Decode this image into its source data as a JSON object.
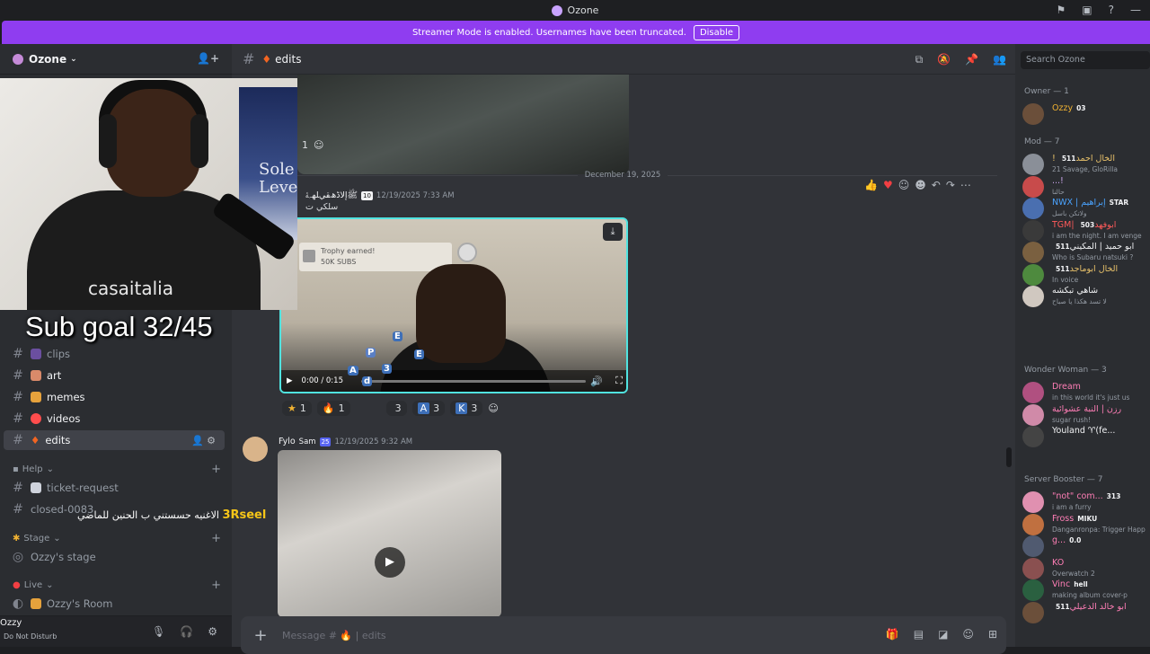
{
  "window": {
    "title": "Ozone"
  },
  "banner": {
    "text": "Streamer Mode is enabled. Usernames have been truncated.",
    "button": "Disable"
  },
  "server": {
    "name": "Ozone"
  },
  "overlay": {
    "subgoal": "Sub goal 32/45",
    "webcam_brand": "casaitalia",
    "poster_text": "Sole Level",
    "donation_name": "3Rseel",
    "donation_message": "الاغنيه حسستني ب الحنين للماضي"
  },
  "sidebar": {
    "channels": [
      {
        "label": "clips"
      },
      {
        "label": "art"
      },
      {
        "label": "memes"
      },
      {
        "label": "videos"
      },
      {
        "label": "edits"
      }
    ],
    "help_category": "Help",
    "help_channels": [
      {
        "label": "ticket-request"
      },
      {
        "label": "closed-0083"
      }
    ],
    "stage_category": "Stage",
    "stage_channel": "Ozzy's stage",
    "live_category": "Live",
    "live_channel": "Ozzy's Room"
  },
  "userbar": {
    "name": "Ozzy",
    "status": "Do Not Disturb"
  },
  "channel": {
    "name": "edits"
  },
  "messages": {
    "date_divider": "December 19, 2025",
    "top_reaction_count": "1",
    "msg1": {
      "author": "ﷺإﻻﮈﮪﻘﻲﻠﻬﮧﮥ",
      "badge": "10",
      "time": "12/19/2025 7:33 AM",
      "text": "سلكي ت"
    },
    "video1": {
      "trophy_title": "Trophy earned!",
      "trophy_sub": "50K SUBS",
      "time": "0:00 / 0:15"
    },
    "reactions1": [
      {
        "emoji": "★",
        "count": "1"
      },
      {
        "emoji": "🔥",
        "count": "1"
      },
      {
        "emoji": "",
        "count": "3"
      },
      {
        "emoji": "A",
        "count": "3"
      },
      {
        "emoji": "K",
        "count": "3"
      }
    ],
    "msg2": {
      "author": "Fylo",
      "tag": "Sam",
      "badge": "25",
      "time": "12/19/2025 9:32 AM"
    }
  },
  "composer": {
    "placeholder": "Message # 🔥 | edits"
  },
  "members": {
    "search_placeholder": "Search Ozone",
    "groups": [
      {
        "title": "Owner — 1",
        "members": [
          {
            "name": "Ozzy",
            "sub": "",
            "tag": "03",
            "color": "#f0b232"
          }
        ]
      },
      {
        "title": "Mod — 7",
        "members": [
          {
            "name": "! الخال احمد",
            "sub": "21 Savage, GloRilla",
            "tag": "511",
            "color": "#e8c16a"
          },
          {
            "name": "...!",
            "sub": "حالنا",
            "tag": "",
            "color": "#c7a3e8"
          },
          {
            "name": "NWX | إبراهيم",
            "sub": "ولاتكن باسل",
            "tag": "STAR",
            "color": "#4aa3ff"
          },
          {
            "name": "TGM| ابوفهد",
            "sub": "i am the night. I am venge",
            "tag": "503",
            "color": "#ff5a5a"
          },
          {
            "name": "ابو حميد | المكيني",
            "sub": "Who is Subaru natsuki ?",
            "tag": "511",
            "color": "#f2f3f5"
          },
          {
            "name": "الخال ابوماجد",
            "sub": "In voice",
            "tag": "511",
            "color": "#e8c16a"
          },
          {
            "name": "شاهي تبكشه",
            "sub": "لا تسد هكذا يا صباح",
            "tag": "",
            "color": "#f2f3f5"
          }
        ]
      },
      {
        "title": "Wonder Woman — 3",
        "members": [
          {
            "name": "Dream",
            "sub": "in this world it's just us",
            "tag": "",
            "color": "#ff7eb6"
          },
          {
            "name": "رزن | النبة عشوائية",
            "sub": "sugar rush!",
            "tag": "",
            "color": "#ff7eb6"
          },
          {
            "name": "Youland ♈(fe...",
            "sub": "",
            "tag": "",
            "color": "#f2f3f5"
          }
        ]
      },
      {
        "title": "Server Booster — 7",
        "members": [
          {
            "name": "\"not\" com...",
            "sub": "i am a furry",
            "tag": "313",
            "color": "#ff7eb6"
          },
          {
            "name": "Fross",
            "sub": "Danganronpa: Trigger Happ",
            "tag": "MIKU",
            "color": "#ff7eb6"
          },
          {
            "name": "g...",
            "sub": "",
            "tag": "0.0",
            "color": "#ff7eb6"
          },
          {
            "name": "KO",
            "sub": "Overwatch 2",
            "tag": "",
            "color": "#ff7eb6"
          },
          {
            "name": "Vinc",
            "sub": "making album cover-p",
            "tag": "hell",
            "color": "#ff7eb6"
          },
          {
            "name": "ابو خالد الدعيلي",
            "sub": "",
            "tag": "511",
            "color": "#ff7eb6"
          }
        ]
      }
    ]
  }
}
